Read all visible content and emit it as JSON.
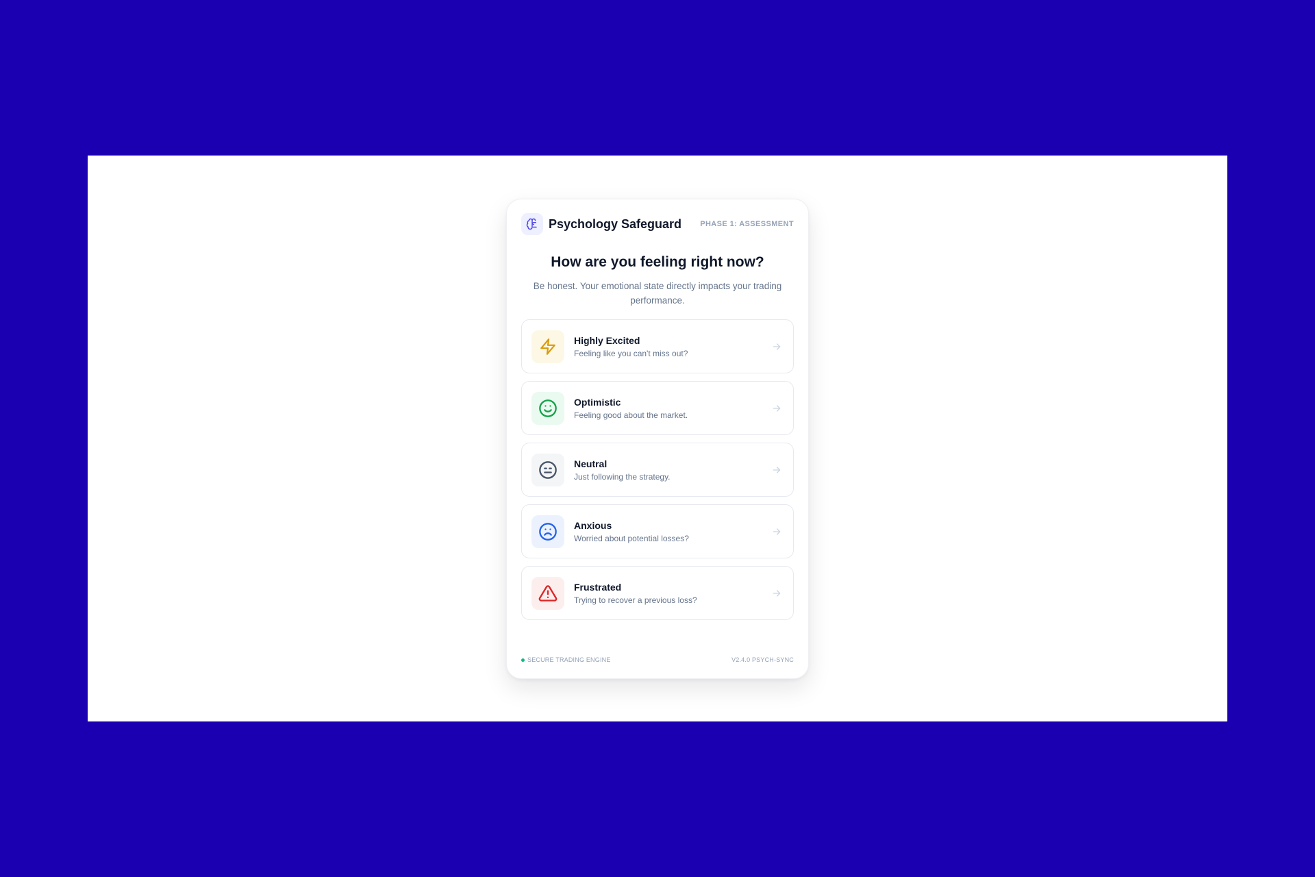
{
  "header": {
    "brand_icon": "brain-icon",
    "title": "Psychology Safeguard",
    "phase": "PHASE 1: ASSESSMENT"
  },
  "question": {
    "title": "How are you feeling right now?",
    "subtitle": "Be honest. Your emotional state directly impacts your trading performance."
  },
  "options": [
    {
      "label": "Highly Excited",
      "desc": "Feeling like you can't miss out?",
      "icon": "lightning-icon",
      "color": "#d99a0b",
      "bg": "#fdf8e6"
    },
    {
      "label": "Optimistic",
      "desc": "Feeling good about the market.",
      "icon": "smile-icon",
      "color": "#16a34a",
      "bg": "#eafaf0"
    },
    {
      "label": "Neutral",
      "desc": "Just following the strategy.",
      "icon": "neutral-face-icon",
      "color": "#475569",
      "bg": "#f4f5f7"
    },
    {
      "label": "Anxious",
      "desc": "Worried about potential losses?",
      "icon": "frown-icon",
      "color": "#2563eb",
      "bg": "#ebf2fd"
    },
    {
      "label": "Frustrated",
      "desc": "Trying to recover a previous loss?",
      "icon": "warning-triangle-icon",
      "color": "#dc2626",
      "bg": "#fdeeee"
    }
  ],
  "footer": {
    "status": "SECURE TRADING ENGINE",
    "version": "V2.4.0 PSYCH-SYNC"
  },
  "colors": {
    "background": "#1a00b0",
    "accent": "#4f46e5"
  }
}
